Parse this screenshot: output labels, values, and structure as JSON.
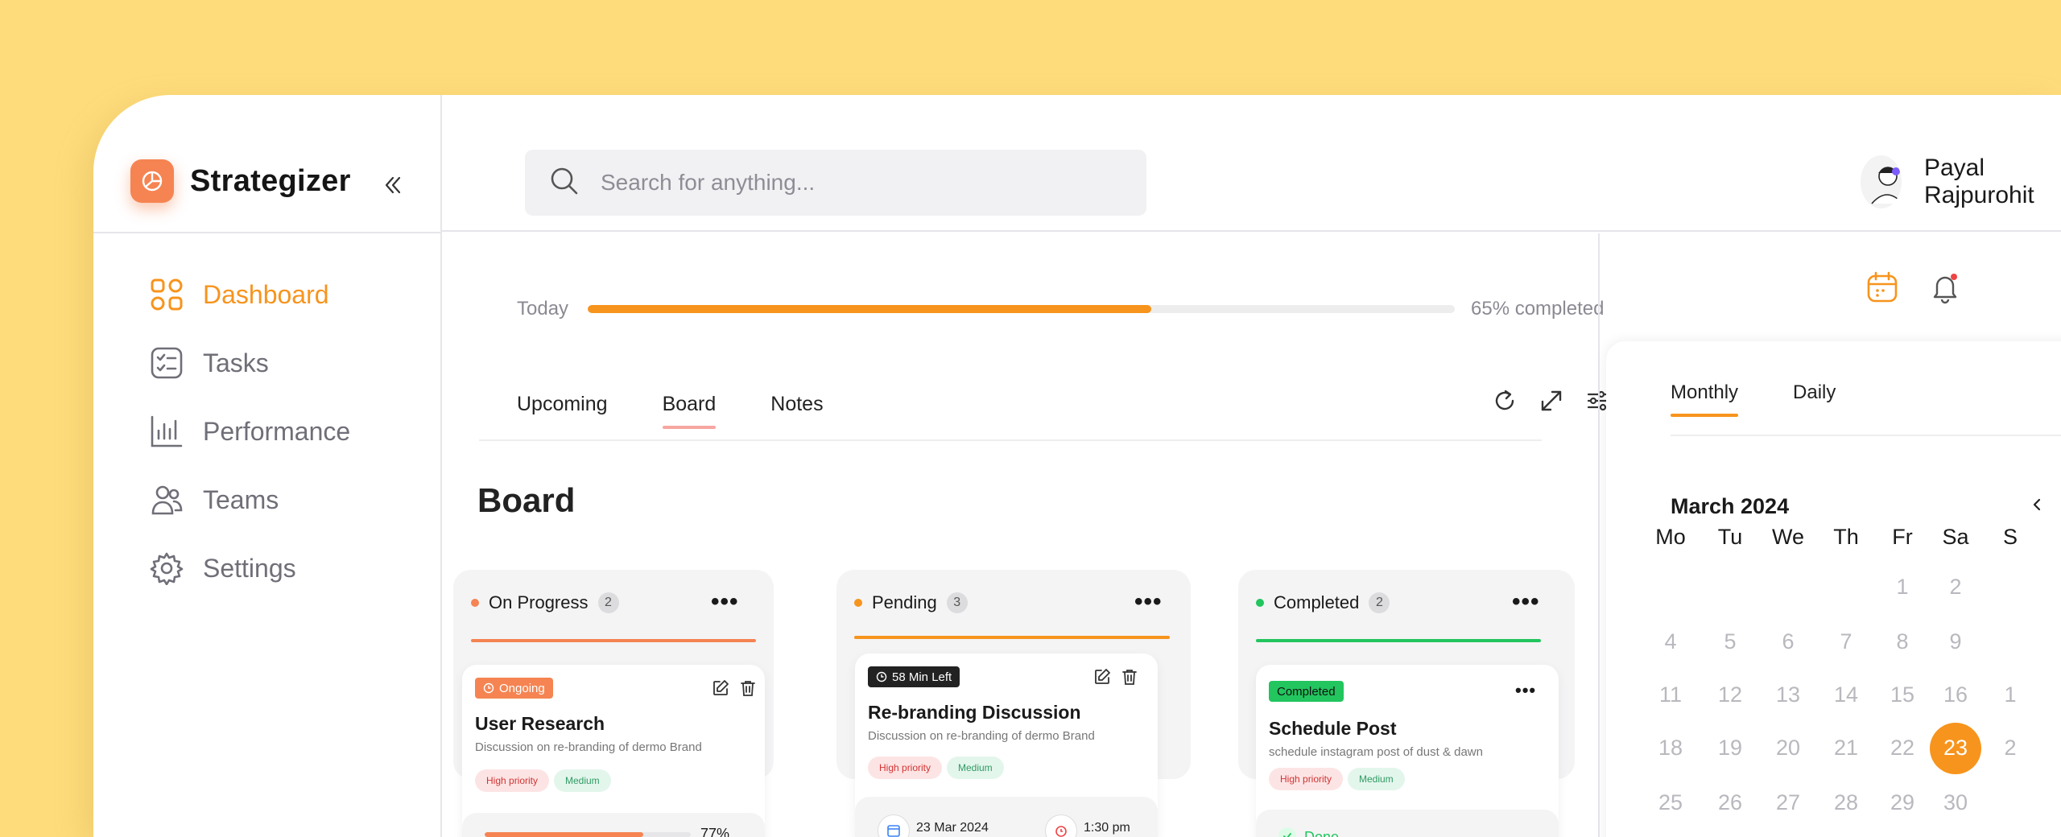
{
  "brand": {
    "name": "Strategizer"
  },
  "sidebar": {
    "items": [
      {
        "label": "Dashboard",
        "icon": "grid-icon",
        "active": true
      },
      {
        "label": "Tasks",
        "icon": "tasks-icon",
        "active": false
      },
      {
        "label": "Performance",
        "icon": "chart-icon",
        "active": false
      },
      {
        "label": "Teams",
        "icon": "teams-icon",
        "active": false
      },
      {
        "label": "Settings",
        "icon": "gear-icon",
        "active": false
      }
    ]
  },
  "search": {
    "placeholder": "Search for anything..."
  },
  "user": {
    "name": "Payal Rajpurohit"
  },
  "progress": {
    "label": "Today",
    "value": 0.65,
    "text": "65% completed"
  },
  "tabs": [
    {
      "label": "Upcoming",
      "active": false
    },
    {
      "label": "Board",
      "active": true
    },
    {
      "label": "Notes",
      "active": false
    }
  ],
  "board": {
    "title": "Board",
    "columns": [
      {
        "title": "On Progress",
        "count": "2",
        "color": "#F58452",
        "card": {
          "chip": "Ongoing",
          "title": "User Research",
          "desc": "Discussion on re-branding of dermo Brand",
          "priority": "High priority",
          "level": "Medium",
          "progress_text": "77%",
          "progress": 0.77
        }
      },
      {
        "title": "Pending",
        "count": "3",
        "color": "#F7941D",
        "card": {
          "chip": "58 Min Left",
          "title": "Re-branding Discussion",
          "desc": "Discussion on re-branding of dermo Brand",
          "priority": "High priority",
          "level": "Medium",
          "date": "23 Mar 2024",
          "time": "1:30 pm"
        }
      },
      {
        "title": "Completed",
        "count": "2",
        "color": "#22C55E",
        "card": {
          "chip": "Completed",
          "title": "Schedule Post",
          "desc": "schedule instagram post of dust & dawn",
          "priority": "High priority",
          "level": "Medium",
          "status": "Done"
        }
      }
    ]
  },
  "calendar": {
    "tabs": [
      {
        "label": "Monthly",
        "active": true
      },
      {
        "label": "Daily",
        "active": false
      }
    ],
    "month": "March 2024",
    "weekdays": [
      "Mo",
      "Tu",
      "We",
      "Th",
      "Fr",
      "Sa",
      "S"
    ],
    "weeks": [
      [
        "",
        "",
        "",
        "",
        "1",
        "2",
        ""
      ],
      [
        "4",
        "5",
        "6",
        "7",
        "8",
        "9",
        ""
      ],
      [
        "11",
        "12",
        "13",
        "14",
        "15",
        "16",
        "1"
      ],
      [
        "18",
        "19",
        "20",
        "21",
        "22",
        "23",
        "2"
      ],
      [
        "25",
        "26",
        "27",
        "28",
        "29",
        "30",
        ""
      ]
    ],
    "today": "23"
  }
}
